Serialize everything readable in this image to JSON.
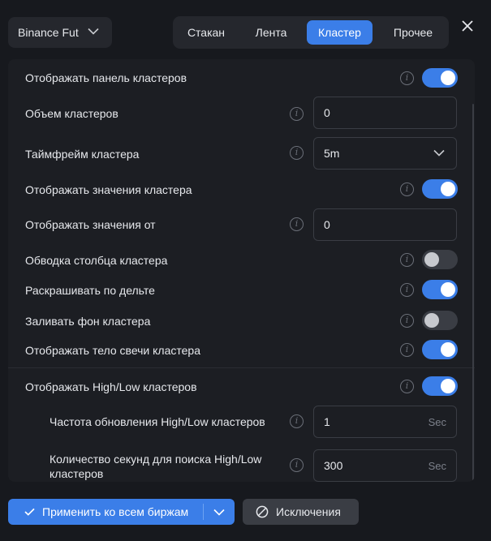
{
  "header": {
    "exchange": "Binance Fut",
    "tabs": [
      {
        "label": "Стакан",
        "active": false
      },
      {
        "label": "Лента",
        "active": false
      },
      {
        "label": "Кластер",
        "active": true
      },
      {
        "label": "Прочее",
        "active": false
      }
    ]
  },
  "settings": {
    "show_cluster_panel": {
      "label": "Отображать панель кластеров",
      "enabled": true
    },
    "cluster_volume": {
      "label": "Объем кластеров",
      "value": "0"
    },
    "cluster_timeframe": {
      "label": "Таймфрейм кластера",
      "value": "5m"
    },
    "show_cluster_values": {
      "label": "Отображать значения кластера",
      "enabled": true
    },
    "show_values_from": {
      "label": "Отображать значения от",
      "value": "0"
    },
    "cluster_column_outline": {
      "label": "Обводка столбца кластера",
      "enabled": false
    },
    "color_by_delta": {
      "label": "Раскрашивать по дельте",
      "enabled": true
    },
    "fill_cluster_background": {
      "label": "Заливать фон кластера",
      "enabled": false
    },
    "show_candle_body": {
      "label": "Отображать тело свечи кластера",
      "enabled": true
    },
    "show_high_low": {
      "label": "Отображать High/Low кластеров",
      "enabled": true
    },
    "high_low_refresh_rate": {
      "label": "Частота обновления High/Low кластеров",
      "value": "1",
      "unit": "Sec"
    },
    "high_low_search_seconds": {
      "label": "Количество секунд для поиска High/Low кластеров",
      "value": "300",
      "unit": "Sec"
    }
  },
  "footer": {
    "apply_label": "Применить ко всем биржам",
    "exclusions_label": "Исключения"
  },
  "colors": {
    "accent": "#3b7ee8",
    "background": "#17191e",
    "panel": "#1c1e23"
  }
}
